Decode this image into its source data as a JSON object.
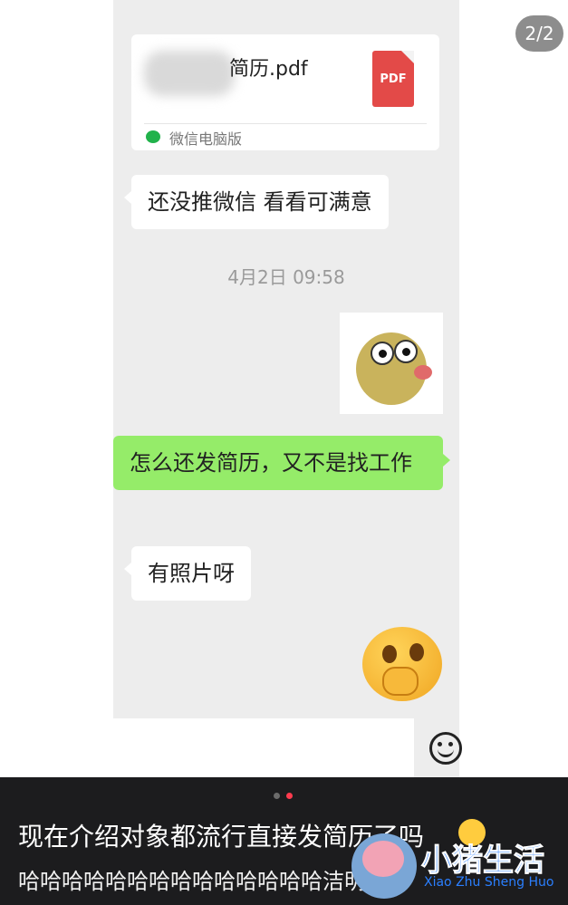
{
  "pager": {
    "label": "2/2"
  },
  "file_card": {
    "filename_visible": "简历.pdf",
    "icon_label": "PDF",
    "source": "微信电脑版"
  },
  "messages": [
    {
      "side": "left",
      "text": "还没推微信 看看可满意"
    },
    {
      "side": "right",
      "text": "怎么还发简历，又不是找工作"
    },
    {
      "side": "left",
      "text": "有照片呀"
    }
  ],
  "timestamp": "4月2日 09:58",
  "stickers": {
    "duck": "duck-sticker",
    "emoji": "face-hand-over-mouth-emoji"
  },
  "input_bar": {
    "emoji_button": "smiley-icon"
  },
  "post": {
    "caption": "现在介绍对象都流行直接发简历了吗",
    "subtext": "哈哈哈哈哈哈哈哈哈哈哈哈哈哈洁明了",
    "indicator_colors": {
      "inactive": "#6b6b6b",
      "active": "#ff3b4e"
    }
  },
  "watermark": {
    "title": "小猪生活",
    "subtitle": "Xiao Zhu Sheng Huo"
  },
  "colors": {
    "chat_bg": "#ededed",
    "green_bubble": "#95ec69",
    "dark_panel": "#1c1c1e",
    "pdf_red": "#e34a48"
  }
}
